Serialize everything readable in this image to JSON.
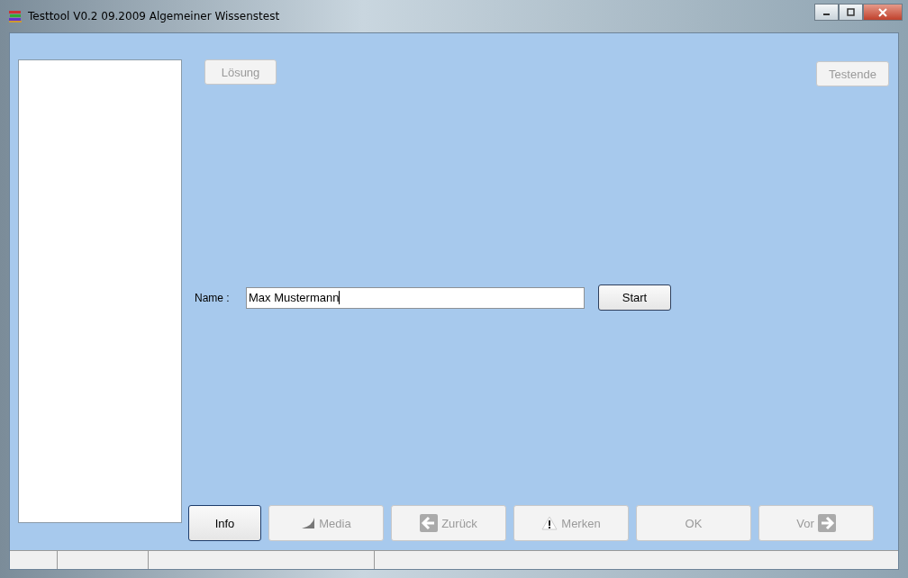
{
  "window": {
    "title": "Testtool V0.2 09.2009 Algemeiner Wissenstest"
  },
  "top_buttons": [
    {
      "label": "Lösung",
      "disabled": true
    },
    {
      "label": "Testende",
      "disabled": true
    }
  ],
  "name_field": {
    "label": "Name :",
    "value": "Max Mustermann"
  },
  "start_button": {
    "label": "Start",
    "disabled": false
  },
  "nav_buttons": [
    {
      "label": "Info",
      "disabled": false,
      "kind": "plain",
      "focused": true
    },
    {
      "label": "Media",
      "disabled": true,
      "kind": "media",
      "focused": false
    },
    {
      "label": "Zurück",
      "disabled": true,
      "kind": "back",
      "focused": false
    },
    {
      "label": "Merken",
      "disabled": true,
      "kind": "mark",
      "focused": false
    },
    {
      "label": "OK",
      "disabled": true,
      "kind": "plain",
      "focused": false
    },
    {
      "label": "Vor",
      "disabled": true,
      "kind": "forward",
      "focused": false
    }
  ]
}
